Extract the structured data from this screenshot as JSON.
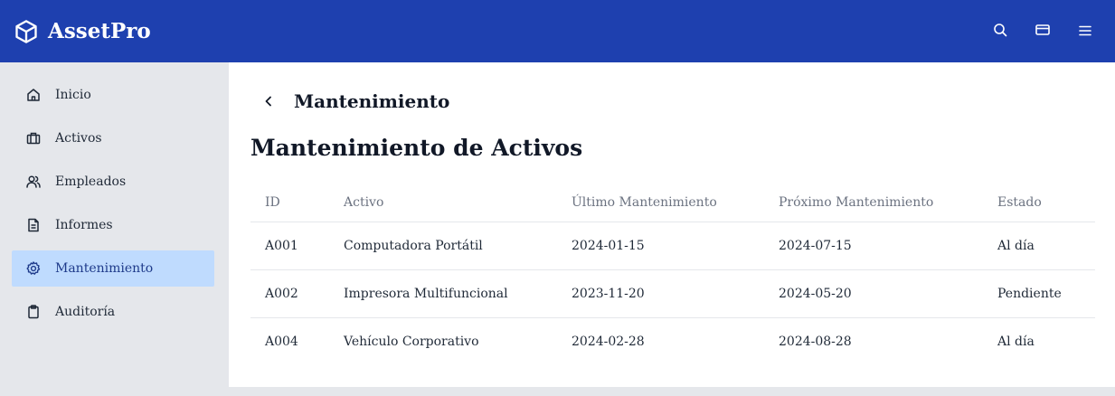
{
  "app": {
    "name": "AssetPro",
    "logo_icon": "cube-icon"
  },
  "topbar": {
    "actions": [
      {
        "icon": "search-icon"
      },
      {
        "icon": "credit-card-icon"
      },
      {
        "icon": "menu-icon"
      }
    ],
    "background": "#1e40af"
  },
  "sidebar": {
    "items": [
      {
        "label": "Inicio",
        "icon": "home-icon",
        "active": false
      },
      {
        "label": "Activos",
        "icon": "briefcase-icon",
        "active": false
      },
      {
        "label": "Empleados",
        "icon": "users-icon",
        "active": false
      },
      {
        "label": "Informes",
        "icon": "document-icon",
        "active": false
      },
      {
        "label": "Mantenimiento",
        "icon": "gear-icon",
        "active": true
      },
      {
        "label": "Auditoría",
        "icon": "clipboard-icon",
        "active": false
      }
    ],
    "active_color": "#bfdbfe"
  },
  "main": {
    "breadcrumb_title": "Mantenimiento",
    "page_title": "Mantenimiento de Activos",
    "table": {
      "headers": [
        "ID",
        "Activo",
        "Último Mantenimiento",
        "Próximo Mantenimiento",
        "Estado"
      ],
      "rows": [
        [
          "A001",
          "Computadora Portátil",
          "2024-01-15",
          "2024-07-15",
          "Al día"
        ],
        [
          "A002",
          "Impresora Multifuncional",
          "2023-11-20",
          "2024-05-20",
          "Pendiente"
        ],
        [
          "A004",
          "Vehículo Corporativo",
          "2024-02-28",
          "2024-08-28",
          "Al día"
        ]
      ]
    }
  }
}
